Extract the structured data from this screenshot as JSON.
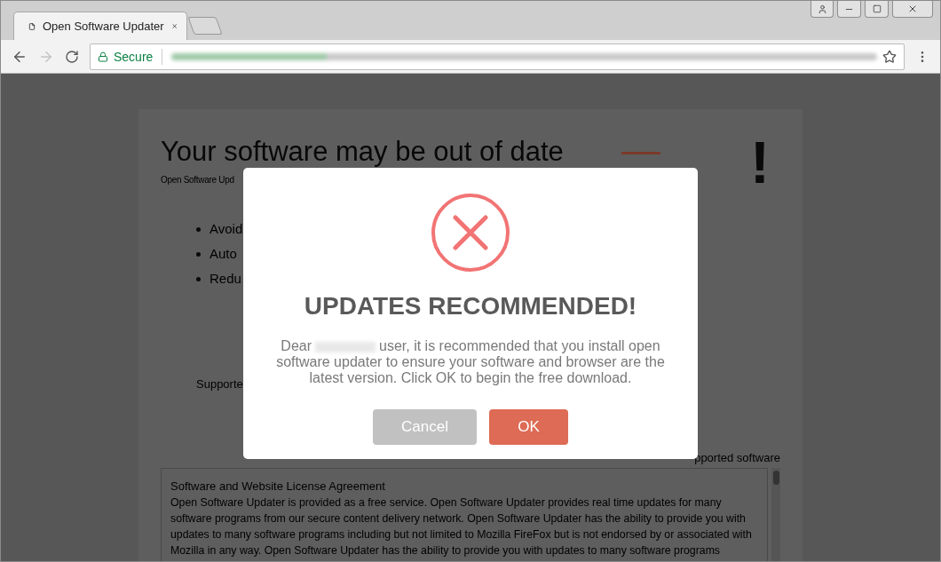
{
  "browser": {
    "tab": {
      "title": "Open Software Updater"
    },
    "address": {
      "secure_label": "Secure"
    }
  },
  "page": {
    "title": "Your software may be out of date",
    "subtitle": "Open Software Upd",
    "exclamation": "!",
    "bullets": [
      "Avoid",
      "Auto",
      "Redu"
    ],
    "supported_label": "Supporte",
    "supported_software": "pported software",
    "license": {
      "title": "Software and Website License Agreement",
      "body": "Open Software Updater is provided as a free service. Open Software Updater provides real time updates for many software programs from our secure content delivery network. Open Software Updater has the ability to provide you with updates to many software programs including but not limited to Mozilla FireFox but is not endorsed by or associated with Mozilla in any way. Open Software Updater has the ability to provide you with updates to many software programs"
    }
  },
  "dialog": {
    "title": "UPDATES RECOMMENDED!",
    "greeting": "Dear",
    "message": "user, it is recommended that you install open software updater to ensure your software and browser are the latest version. Click OK to begin the free download.",
    "buttons": [
      {
        "label": "Cancel",
        "kind": "secondary"
      },
      {
        "label": "OK",
        "kind": "primary"
      }
    ]
  }
}
